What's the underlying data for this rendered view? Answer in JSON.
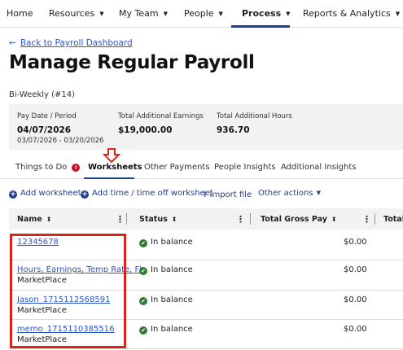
{
  "nav": {
    "items": [
      {
        "label": "Home",
        "chevron": false
      },
      {
        "label": "Resources",
        "chevron": true
      },
      {
        "label": "My Team",
        "chevron": true
      },
      {
        "label": "People",
        "chevron": true
      },
      {
        "label": "Process",
        "chevron": true,
        "active": true
      },
      {
        "label": "Reports & Analytics",
        "chevron": true
      }
    ]
  },
  "back_link": "Back to Payroll Dashboard",
  "title": "Manage Regular Payroll",
  "subtitle": "Bi-Weekly (#14)",
  "summary": {
    "pay_date_label": "Pay Date / Period",
    "pay_date_value": "04/07/2026",
    "pay_period": "03/07/2026 - 03/20/2026",
    "earnings_label": "Total Additional Earnings",
    "earnings_value": "$19,000.00",
    "hours_label": "Total Additional Hours",
    "hours_value": "936.70"
  },
  "tabs": [
    {
      "label": "Things to Do",
      "badge": "!"
    },
    {
      "label": "Worksheets",
      "active": true
    },
    {
      "label": "Other Payments"
    },
    {
      "label": "People Insights"
    },
    {
      "label": "Additional Insights"
    }
  ],
  "actions": {
    "add_worksheet": "Add worksheet",
    "add_time_off": "Add time / time off worksheet",
    "import_file": "Import file",
    "other_actions": "Other actions"
  },
  "table": {
    "columns": [
      "Name",
      "Status",
      "Total Gross Pay",
      "Total H"
    ],
    "rows": [
      {
        "name": "12345678",
        "sub": "",
        "status": "In balance",
        "gross": "$0.00"
      },
      {
        "name": "Hours, Earnings, Temp Rate, Fl",
        "sub": "MarketPlace",
        "status": "In balance",
        "gross": "$0.00"
      },
      {
        "name": "Jason_1715112568591",
        "sub": "MarketPlace",
        "status": "In balance",
        "gross": "$0.00"
      },
      {
        "name": "memo_1715110385516",
        "sub": "MarketPlace",
        "status": "In balance",
        "gross": "$0.00"
      }
    ]
  },
  "colors": {
    "accent": "#1f3e8c",
    "link": "#2a55c7",
    "highlight": "#d9261c",
    "success": "#2e7d32"
  }
}
